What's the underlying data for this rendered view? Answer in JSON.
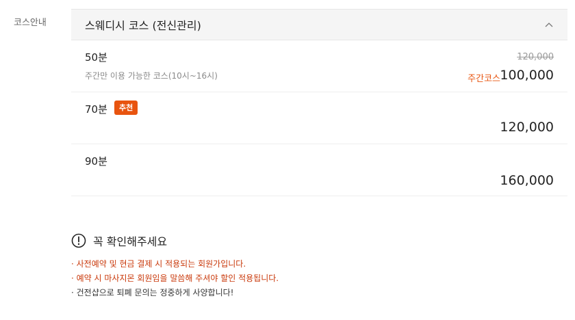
{
  "side_label": "코스안내",
  "course": {
    "title": "스웨디시 코스 (전신관리)",
    "rows": [
      {
        "duration": "50분",
        "description": "주간만 이용 가능한 코스(10시~16시)",
        "old_price": "120,000",
        "price_tag": "주간코스",
        "price": "100,000"
      },
      {
        "duration": "70분",
        "badge": "추천",
        "price": "120,000"
      },
      {
        "duration": "90분",
        "price": "160,000"
      }
    ]
  },
  "notice": {
    "title": "꼭 확인해주세요",
    "items": [
      "· 사전예약 및 현금 결제 시 적용되는 회원가입니다.",
      "· 예약 시 마사지몬 회원임을 말씀해 주셔야 할인 적용됩니다.",
      "· 건전샵으로 퇴폐 문의는 정중하게 사양합니다!"
    ]
  },
  "colors": {
    "accent": "#e8540f",
    "notice_red": "#c9380a",
    "header_bg": "#f5f5f5"
  }
}
